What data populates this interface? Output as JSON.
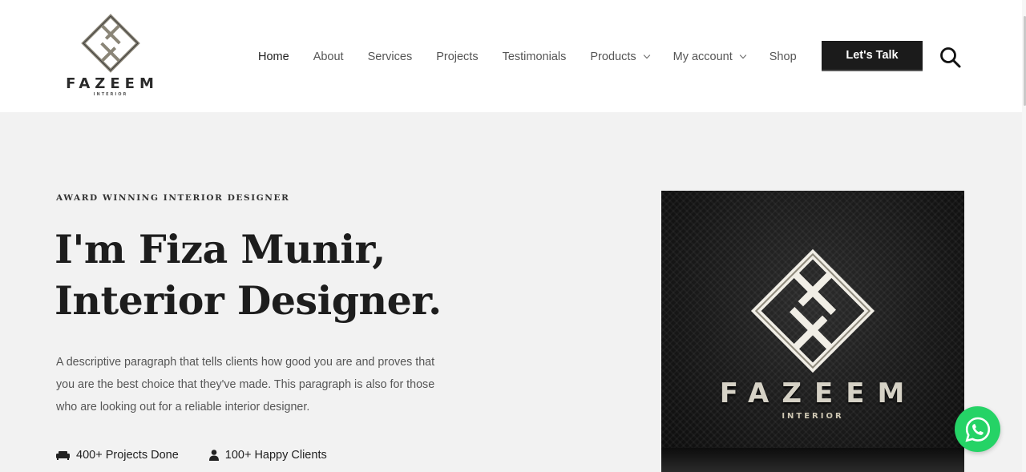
{
  "brand": {
    "name": "FAZEEM",
    "sub": "INTERIOR"
  },
  "nav": {
    "items": [
      {
        "label": "Home",
        "dropdown": false
      },
      {
        "label": "About",
        "dropdown": false
      },
      {
        "label": "Services",
        "dropdown": false
      },
      {
        "label": "Projects",
        "dropdown": false
      },
      {
        "label": "Testimonials",
        "dropdown": false
      },
      {
        "label": "Products",
        "dropdown": true
      },
      {
        "label": "My account",
        "dropdown": true
      },
      {
        "label": "Shop",
        "dropdown": false
      }
    ],
    "cta_label": "Let's Talk",
    "search_icon": "search-icon"
  },
  "hero": {
    "eyebrow": "AWARD WINNING INTERIOR DESIGNER",
    "title_line1": "I'm Fiza Munir,",
    "title_line2": "Interior Designer.",
    "description": "A descriptive paragraph that tells clients how good you are and proves that you are the best choice that they've made. This paragraph is also for those who are looking out for a reliable interior designer.",
    "stats": [
      {
        "icon": "sofa-icon",
        "label": "400+ Projects Done"
      },
      {
        "icon": "user-icon",
        "label": "100+ Happy Clients"
      }
    ],
    "image_brand": "FAZEEM",
    "image_sub": "INTERIOR"
  },
  "floating": {
    "icon": "whatsapp-icon",
    "color": "#25d366"
  },
  "colors": {
    "accent": "#1b1b1b",
    "background": "#f2f2f2"
  }
}
